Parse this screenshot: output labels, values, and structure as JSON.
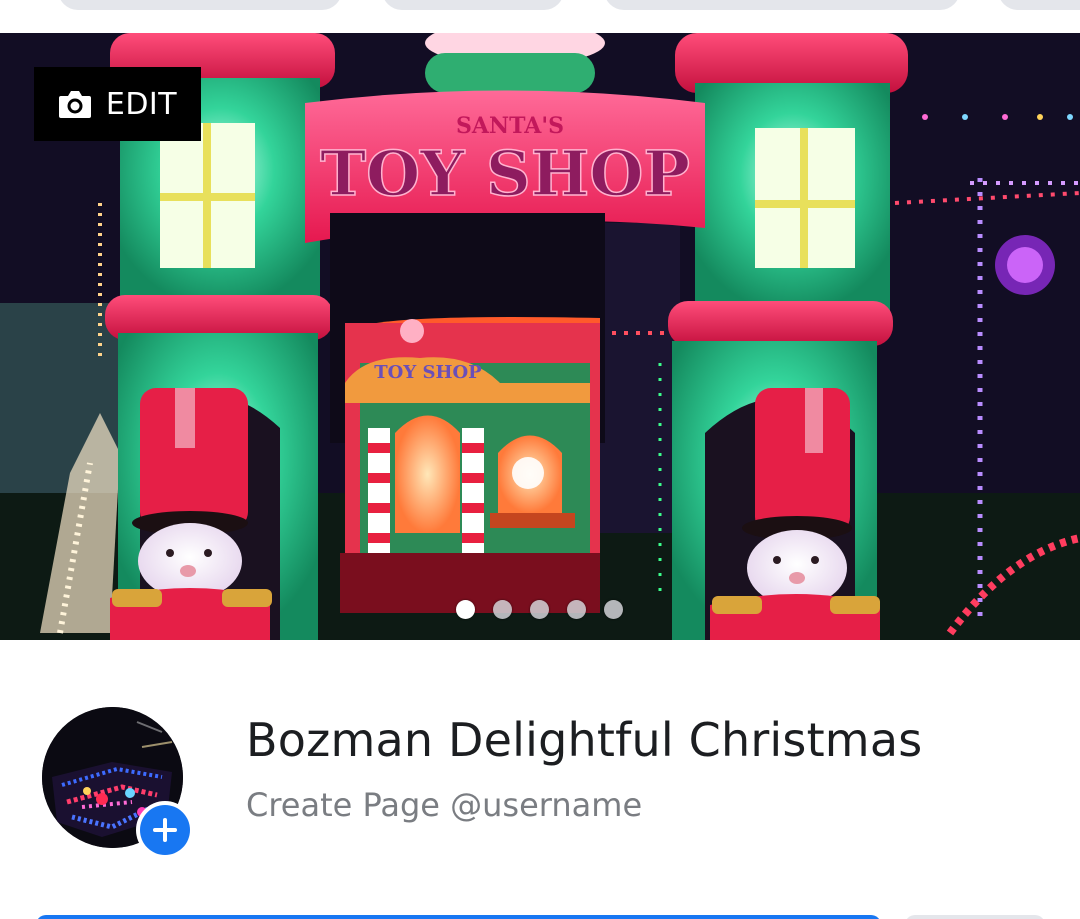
{
  "cover": {
    "edit_label": "EDIT",
    "banner_small": "SANTA'S",
    "banner_big": "TOY SHOP",
    "booth_sign": "TOY SHOP",
    "slide_count": 5,
    "active_slide": 1
  },
  "profile": {
    "name": "Bozman Delightful Christmas",
    "username_prompt": "Create Page @username"
  },
  "icons": {
    "edit": "camera-icon",
    "add": "plus-icon"
  },
  "colors": {
    "accent": "#1877f2",
    "name_text": "#1c1e21",
    "secondary_text": "#7a7d82",
    "edit_bg": "#000000"
  }
}
